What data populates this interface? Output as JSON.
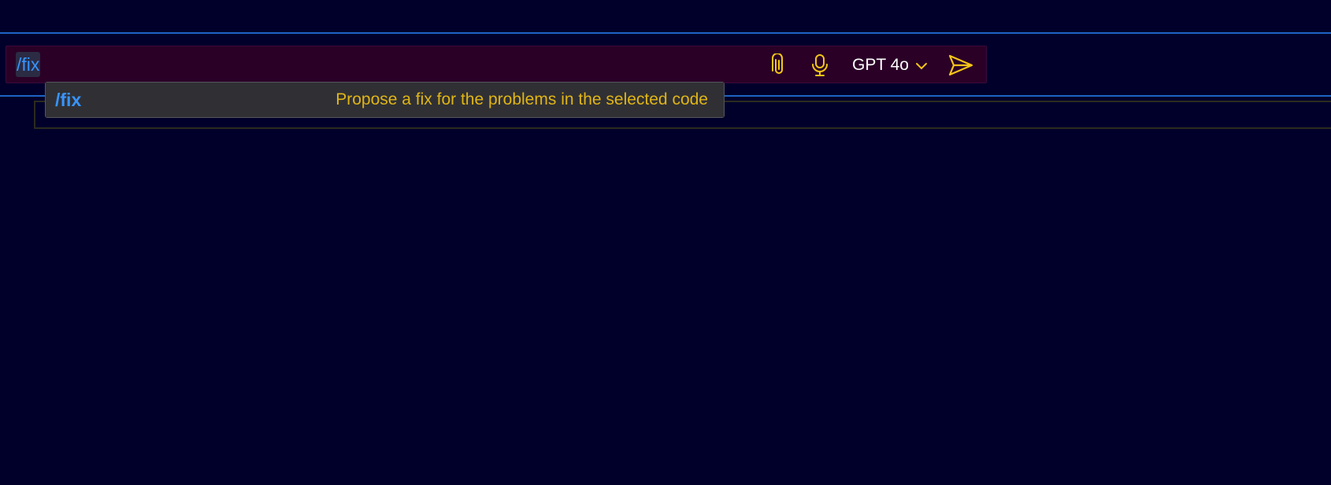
{
  "chat_input": {
    "value": "/fix"
  },
  "toolbar": {
    "attach_icon": "paperclip-icon",
    "mic_icon": "microphone-icon",
    "model_label": "GPT 4o",
    "model_chevron_icon": "chevron-down-icon",
    "send_icon": "send-icon"
  },
  "suggestions": [
    {
      "command": "/fix",
      "description": "Propose a fix for the problems in the selected code"
    }
  ],
  "colors": {
    "background": "#00002b",
    "accent_line": "#1e63c4",
    "input_bg": "#2a0027",
    "icon": "#f5c518",
    "command": "#3794ff",
    "description": "#e0b516"
  }
}
